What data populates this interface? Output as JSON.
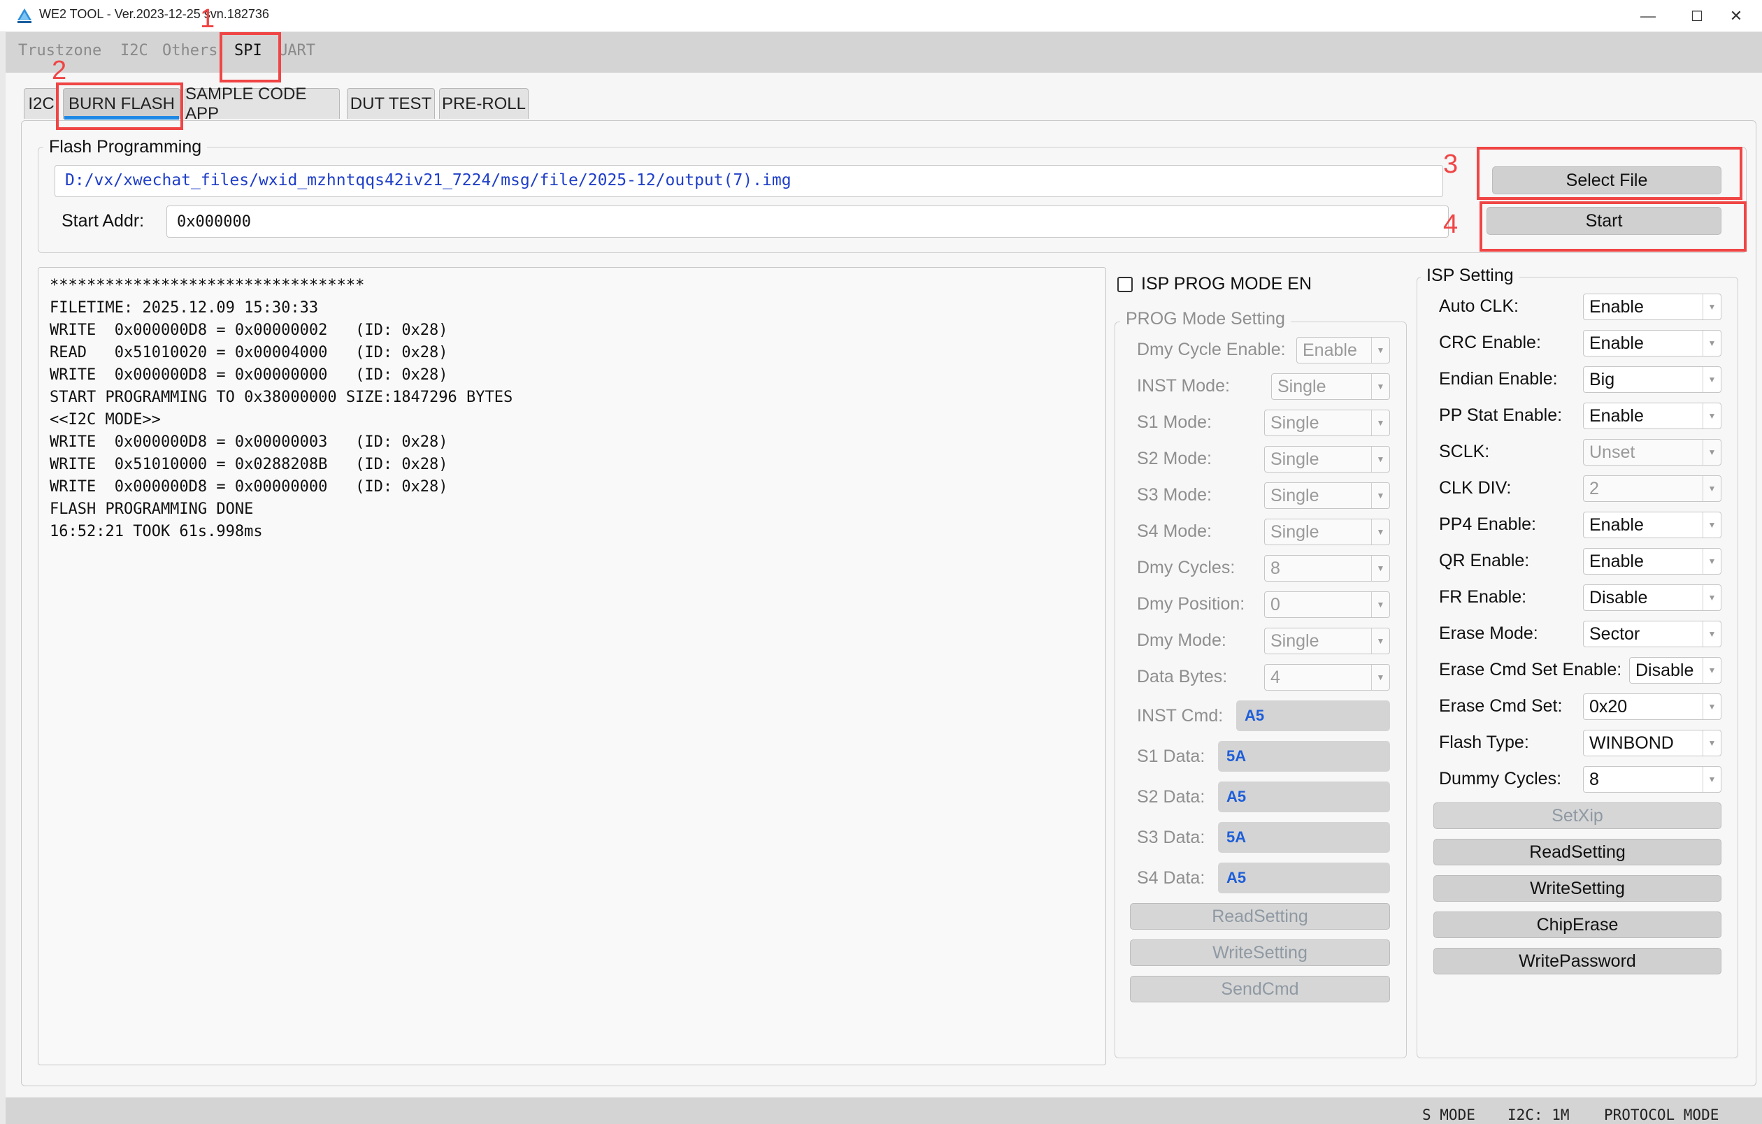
{
  "window": {
    "title": "WE2 TOOL - Ver.2023-12-25 svn.182736",
    "minimize": "—",
    "maximize": "☐",
    "close": "✕"
  },
  "menu": {
    "items": [
      "Trustzone",
      "I2C",
      "Others",
      "SPI",
      "UART"
    ],
    "active": "SPI"
  },
  "tabs": {
    "items": [
      "I2C",
      "BURN FLASH",
      "SAMPLE CODE APP",
      "DUT TEST",
      "PRE-ROLL"
    ],
    "active": "BURN FLASH"
  },
  "annotations": [
    "1",
    "2",
    "3",
    "4"
  ],
  "flash_programming": {
    "title": "Flash Programming",
    "file_path": "D:/vx/xwechat_files/wxid_mzhntqqs42iv21_7224/msg/file/2025-12/output(7).img",
    "start_addr_label": "Start Addr:",
    "start_addr_value": "0x000000",
    "select_file_button": "Select File",
    "start_button": "Start"
  },
  "log": [
    "**********************************",
    "FILETIME: 2025.12.09 15:30:33",
    "WRITE  0x000000D8 = 0x00000002   (ID: 0x28)",
    "READ   0x51010020 = 0x00004000   (ID: 0x28)",
    "WRITE  0x000000D8 = 0x00000000   (ID: 0x28)",
    "START PROGRAMMING TO 0x38000000 SIZE:1847296 BYTES",
    "<<I2C MODE>>",
    "WRITE  0x000000D8 = 0x00000003   (ID: 0x28)",
    "WRITE  0x51010000 = 0x0288208B   (ID: 0x28)",
    "WRITE  0x000000D8 = 0x00000000   (ID: 0x28)",
    "FLASH PROGRAMMING DONE",
    "16:52:21 TOOK 61s.998ms"
  ],
  "isp_prog_mode": {
    "checkbox_label": "ISP PROG MODE EN",
    "checked": false,
    "group_title": "PROG Mode Setting",
    "rows": [
      {
        "label": "Dmy Cycle Enable:",
        "value": "Enable"
      },
      {
        "label": "INST Mode:",
        "value": "Single"
      },
      {
        "label": "S1 Mode:",
        "value": "Single"
      },
      {
        "label": "S2 Mode:",
        "value": "Single"
      },
      {
        "label": "S3 Mode:",
        "value": "Single"
      },
      {
        "label": "S4 Mode:",
        "value": "Single"
      },
      {
        "label": "Dmy Cycles:",
        "value": "8"
      },
      {
        "label": "Dmy Position:",
        "value": "0"
      },
      {
        "label": "Dmy Mode:",
        "value": "Single"
      },
      {
        "label": "Data Bytes:",
        "value": "4"
      }
    ],
    "hex_rows": [
      {
        "label": "INST Cmd:",
        "value": "A5"
      },
      {
        "label": "S1 Data:",
        "value": "5A"
      },
      {
        "label": "S2 Data:",
        "value": "A5"
      },
      {
        "label": "S3 Data:",
        "value": "5A"
      },
      {
        "label": "S4 Data:",
        "value": "A5"
      }
    ],
    "buttons": [
      "ReadSetting",
      "WriteSetting",
      "SendCmd"
    ]
  },
  "isp_setting": {
    "title": "ISP Setting",
    "rows": [
      {
        "label": "Auto CLK:",
        "value": "Enable",
        "enabled": true
      },
      {
        "label": "CRC Enable:",
        "value": "Enable",
        "enabled": true
      },
      {
        "label": "Endian Enable:",
        "value": "Big",
        "enabled": true
      },
      {
        "label": "PP Stat Enable:",
        "value": "Enable",
        "enabled": true
      },
      {
        "label": "SCLK:",
        "value": "Unset",
        "enabled": false
      },
      {
        "label": "CLK DIV:",
        "value": "2",
        "enabled": false
      },
      {
        "label": "PP4 Enable:",
        "value": "Enable",
        "enabled": true
      },
      {
        "label": "QR Enable:",
        "value": "Enable",
        "enabled": true
      },
      {
        "label": "FR Enable:",
        "value": "Disable",
        "enabled": true
      },
      {
        "label": "Erase Mode:",
        "value": "Sector",
        "enabled": true
      },
      {
        "label": "Erase Cmd Set Enable:",
        "value": "Disable",
        "enabled": true
      },
      {
        "label": "Erase Cmd Set:",
        "value": "0x20",
        "enabled": true
      },
      {
        "label": "Flash Type:",
        "value": "WINBOND",
        "enabled": true
      },
      {
        "label": "Dummy Cycles:",
        "value": "8",
        "enabled": true
      }
    ],
    "buttons": [
      {
        "label": "SetXip",
        "enabled": false
      },
      {
        "label": "ReadSetting",
        "enabled": true
      },
      {
        "label": "WriteSetting",
        "enabled": true
      },
      {
        "label": "ChipErase",
        "enabled": true
      },
      {
        "label": "WritePassword",
        "enabled": true
      }
    ]
  },
  "status": {
    "items": [
      "S MODE",
      "I2C: 1M",
      "PROTOCOL MODE"
    ]
  }
}
